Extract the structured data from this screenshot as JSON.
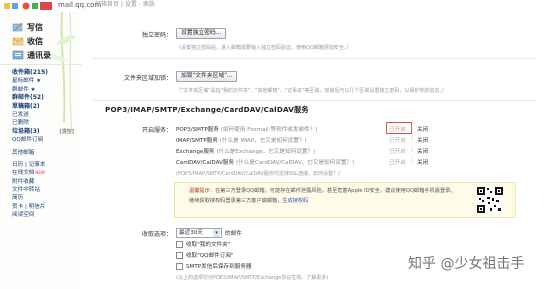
{
  "topbar": {
    "domain": "mail.qq.com",
    "crumbs": "邮箱首页 | 设置 - 换肤"
  },
  "sidebar": {
    "actions": [
      {
        "label": "写信",
        "icon": "pencil-icon"
      },
      {
        "label": "收信",
        "icon": "inbox-icon"
      },
      {
        "label": "通讯录",
        "icon": "contacts-icon"
      }
    ],
    "items": [
      {
        "label": "收件箱(215)",
        "bold": true
      },
      {
        "label": "星标邮件 ★",
        "bold": false
      },
      {
        "label": "群邮件 ★",
        "bold": false
      },
      {
        "label": "群邮件(52)",
        "bold": true
      },
      {
        "label": "草稿箱(2)",
        "bold": true
      },
      {
        "label": "已发送",
        "bold": false
      },
      {
        "label": "已删除",
        "bold": false
      },
      {
        "label": "垃圾箱(3)",
        "bold": true,
        "extra": "[清空]"
      },
      {
        "label": "QQ邮件订阅",
        "bold": false
      },
      {
        "sep": true
      },
      {
        "label": "其他邮箱",
        "bold": false
      },
      {
        "sep": true
      },
      {
        "label": "日历 | 记事本",
        "bold": false
      },
      {
        "label": "在线文档",
        "bold": false,
        "new": "NEW"
      },
      {
        "label": "附件收藏",
        "bold": false
      },
      {
        "label": "文件中转站",
        "bold": false
      },
      {
        "label": "简历",
        "bold": false
      },
      {
        "label": "贺卡 | 明信片",
        "bold": false
      },
      {
        "label": "阅读空间",
        "bold": false
      }
    ]
  },
  "settings": {
    "password_label": "独立密码：",
    "password_button": "设置独立密码...",
    "password_hint": "（设置独立密码后，进入邮箱需要输入独立密码验证，使用QQ邮箱更加安全。）",
    "folder_label": "文件夹区域加锁：",
    "folder_button": "加锁\"文件夹区域\"...",
    "folder_hint": "（\"文件夹区域\"是指\"我的文件夹\"、\"其他邮箱\"、\"记事本\"等区域，加锁后可以几个区域设置独立密码，以保护你的信息。）"
  },
  "pop": {
    "section_title": "POP3/IMAP/SMTP/Exchange/CardDAV/CalDAV服务",
    "open_label": "开启服务：",
    "services": [
      {
        "name": "POP3/SMTP服务",
        "question": "(如何使用 Foxmail 等软件收发邮件？)",
        "state": "已开启",
        "toggle": "关闭"
      },
      {
        "name": "IMAP/SMTP服务",
        "question": "(什么是 IMAP，它又是如何设置？)",
        "state": "已开启",
        "toggle": "关闭"
      },
      {
        "name": "Exchange服务",
        "question": "(什么是Exchange，它又是如何设置？)",
        "state": "已开启",
        "toggle": "关闭"
      },
      {
        "name": "CardDAV/CalDAV服务",
        "question": "(什么是CardDAV/CalDAV，它又是如何设置？)",
        "state": "已开启",
        "toggle": "关闭"
      }
    ],
    "services_note": "(POP3/IMAP/SMTP/CardDAV/CalDAV服务均支持SSL连接。如何设置？)",
    "tip_label": "温馨提示：",
    "tip_line1": "在第三方登录QQ邮箱，可能存在邮件泄露风险，甚至危害Apple ID安全，建议使用QQ邮箱手机版登录。",
    "tip_line2": "继续获取授权码登录第三方客户端邮箱",
    "tip_link": "生成授权码",
    "receive_label": "收取选项：",
    "receive_select": "最近30天",
    "receive_suffix": "的邮件",
    "checks": [
      "收取\"我的文件夹\"",
      "收取\"QQ邮件订阅\"",
      "SMTP发信后保存到服务器"
    ],
    "checks_note": "(以上的选项仅对POP3/IMAP/SMTP/Exchange协议生效。了解更多)"
  },
  "watermark": "知乎 @少女祖击手",
  "colors": {
    "link": "#1a3d7a",
    "highlight": "#d9534f",
    "tip_bg": "#fefbe8"
  }
}
